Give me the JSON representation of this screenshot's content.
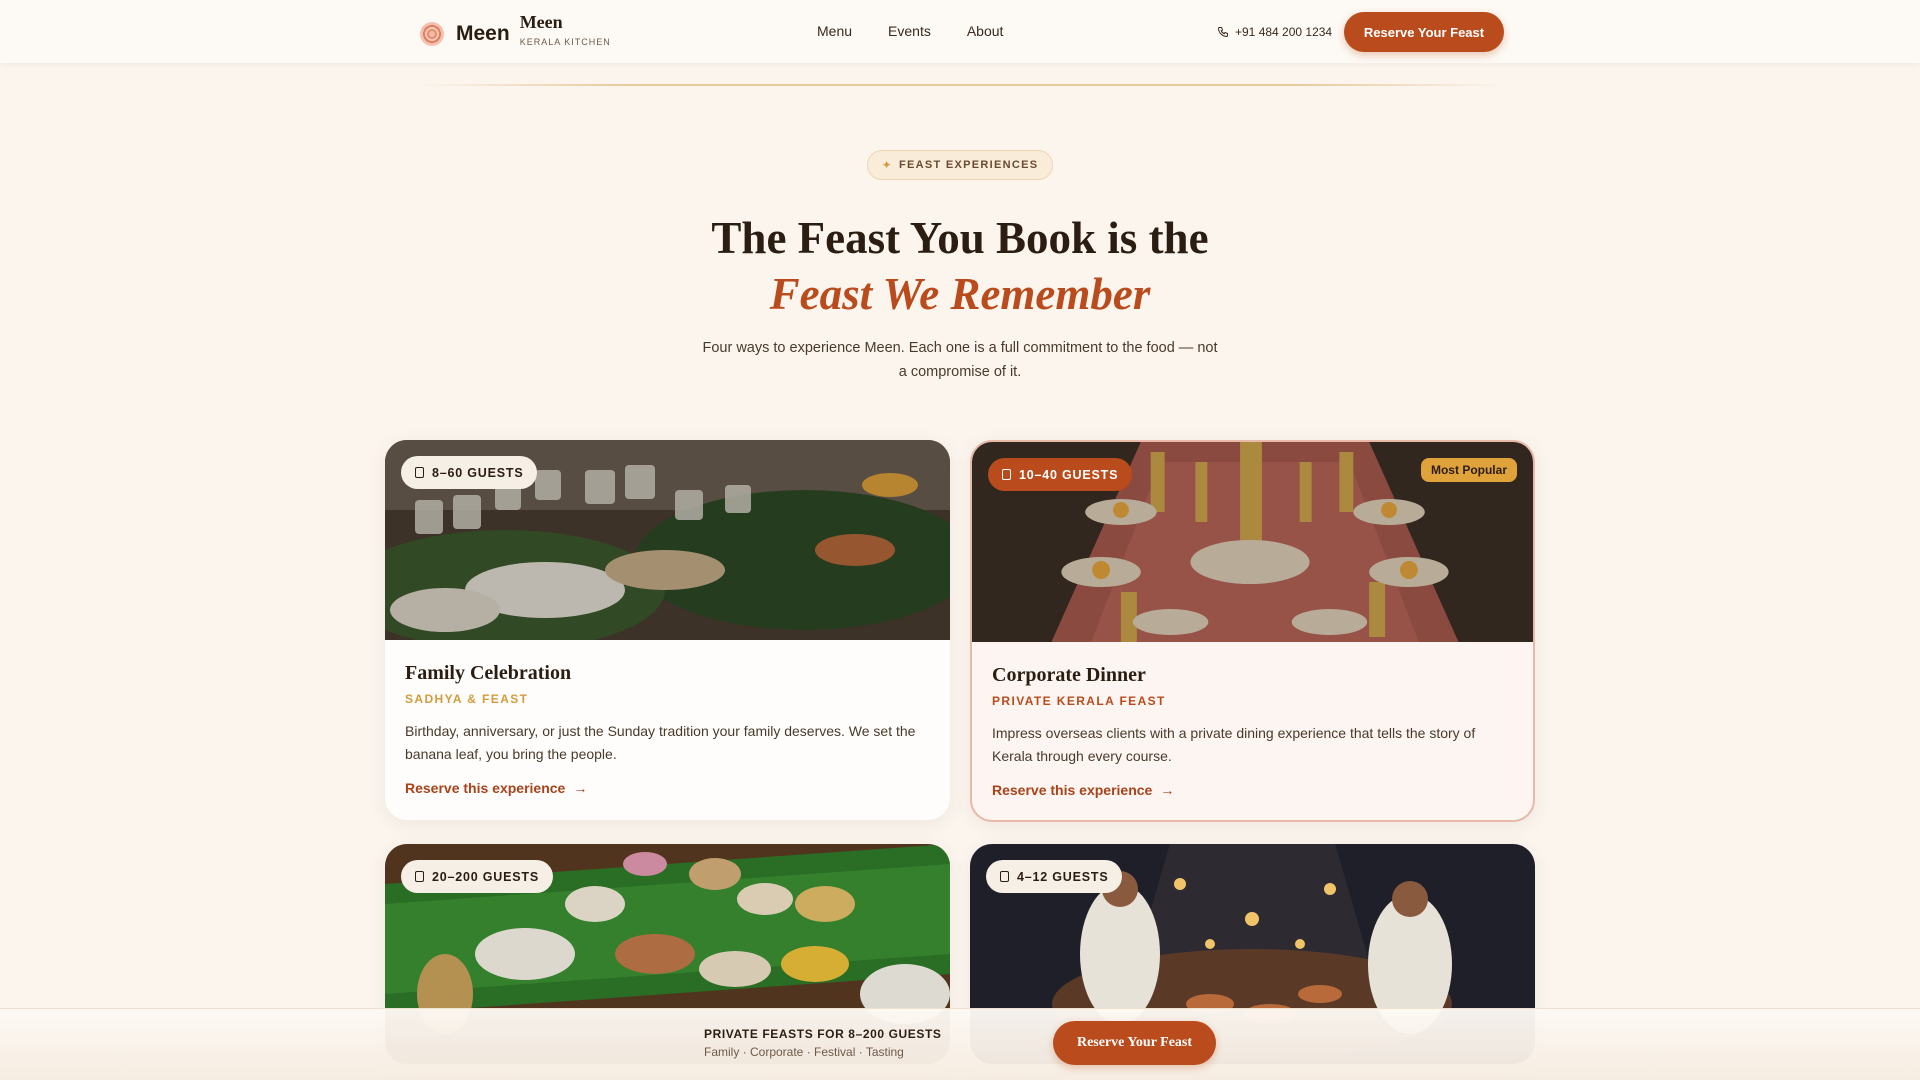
{
  "header": {
    "brand_name": "Meen",
    "brand_sub_name": "Meen",
    "brand_tagline": "KERALA KITCHEN",
    "nav": [
      "Menu",
      "Events",
      "About"
    ],
    "phone": "+91 484 200 1234",
    "cta_label": "Reserve Your Feast"
  },
  "hero": {
    "eyebrow": "FEAST EXPERIENCES",
    "title_line1": "The Feast You Book is the",
    "title_line2": "Feast We Remember",
    "subtitle": "Four ways to experience Meen. Each one is a full commitment to the food — not a compromise of it."
  },
  "cards": [
    {
      "guests": "8–60 GUESTS",
      "title": "Family Celebration",
      "subtitle": "SADHYA & FEAST",
      "subtitle_color": "#d39c3d",
      "description": "Birthday, anniversary, or just the Sunday tradition your family deserves. We set the banana leaf, you bring the people.",
      "link": "Reserve this experience"
    },
    {
      "guests": "10–40 GUESTS",
      "badge": "Most Popular",
      "title": "Corporate Dinner",
      "subtitle": "PRIVATE KERALA FEAST",
      "subtitle_color": "#b94b1c",
      "description": "Impress overseas clients with a private dining experience that tells the story of Kerala through every course.",
      "link": "Reserve this experience"
    },
    {
      "guests": "20–200 GUESTS"
    },
    {
      "guests": "4–12 GUESTS"
    }
  ],
  "sticky": {
    "title": "PRIVATE FEASTS FOR 8–200 GUESTS",
    "tags": "Family · Corporate · Festival · Tasting",
    "cta_label": "Reserve Your Feast"
  },
  "colors": {
    "accent": "#b94b1c",
    "gold": "#d39c3d",
    "background": "#fbf5ee",
    "text": "#2b1d12"
  }
}
